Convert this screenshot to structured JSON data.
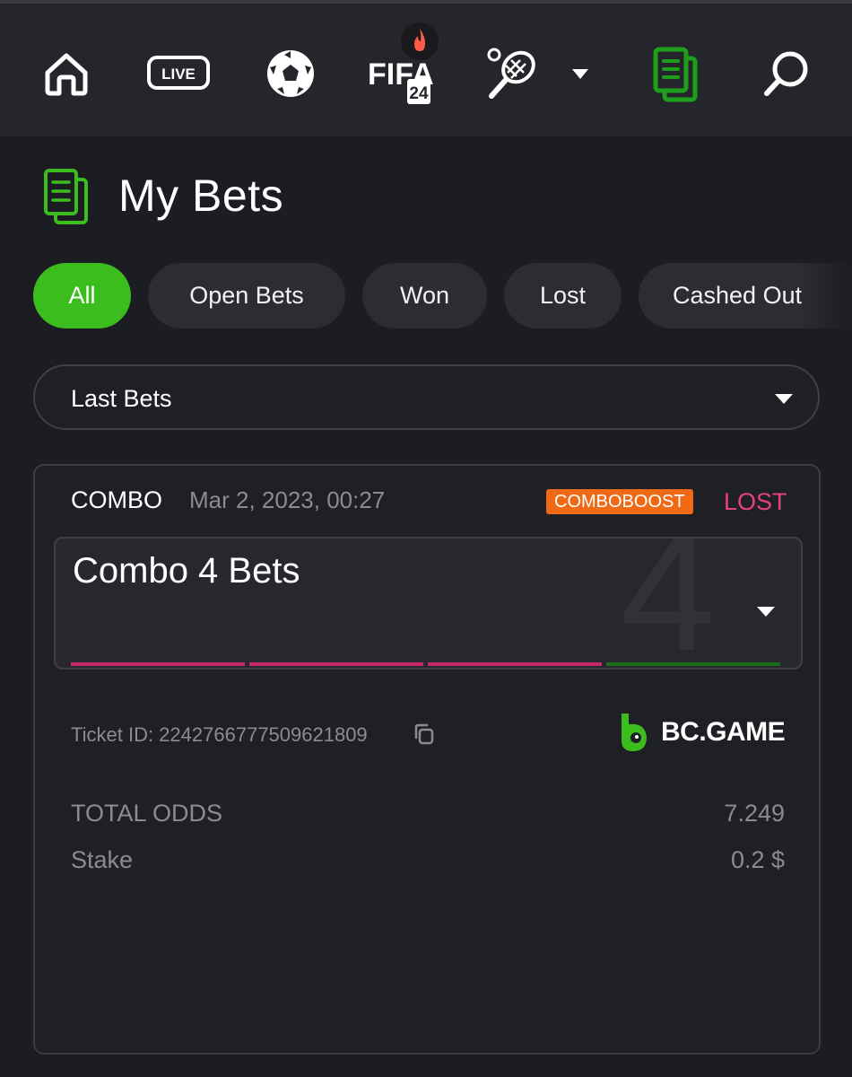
{
  "nav": {
    "items": [
      {
        "icon": "home-icon"
      },
      {
        "icon": "live-icon",
        "label": "LIVE"
      },
      {
        "icon": "soccer-ball-icon"
      },
      {
        "icon": "fifa-icon",
        "label": "FIFA",
        "sub": "24",
        "hot_icon": "flame-icon"
      },
      {
        "icon": "tennis-racket-icon"
      },
      {
        "icon": "chevron-down-icon"
      },
      {
        "icon": "my-bets-icon"
      },
      {
        "icon": "search-icon"
      }
    ],
    "active_color": "#1e9e1a"
  },
  "header": {
    "title": "My Bets",
    "icon": "my-bets-icon"
  },
  "filters": {
    "chips": [
      "All",
      "Open Bets",
      "Won",
      "Lost",
      "Cashed Out"
    ],
    "active": "All",
    "active_color": "#3bbd1e"
  },
  "select": {
    "value": "Last Bets"
  },
  "bet": {
    "type": "COMBO",
    "date": "Mar 2, 2023, 00:27",
    "badge": "COMBOBOOST",
    "status": "LOST",
    "status_color": "#e9407a",
    "combo_title": "Combo 4 Bets",
    "combo_count": "4",
    "legs": [
      {
        "result": "lost",
        "color": "#c8266a"
      },
      {
        "result": "lost",
        "color": "#c8266a"
      },
      {
        "result": "lost",
        "color": "#c8266a"
      },
      {
        "result": "won",
        "color": "#1a6e1a"
      }
    ],
    "ticket_label": "Ticket ID: 2242766777509621809",
    "brand": "BC.GAME",
    "total_odds_label": "TOTAL ODDS",
    "total_odds_value": "7.249",
    "stake_label": "Stake",
    "stake_value": "0.2 $"
  }
}
